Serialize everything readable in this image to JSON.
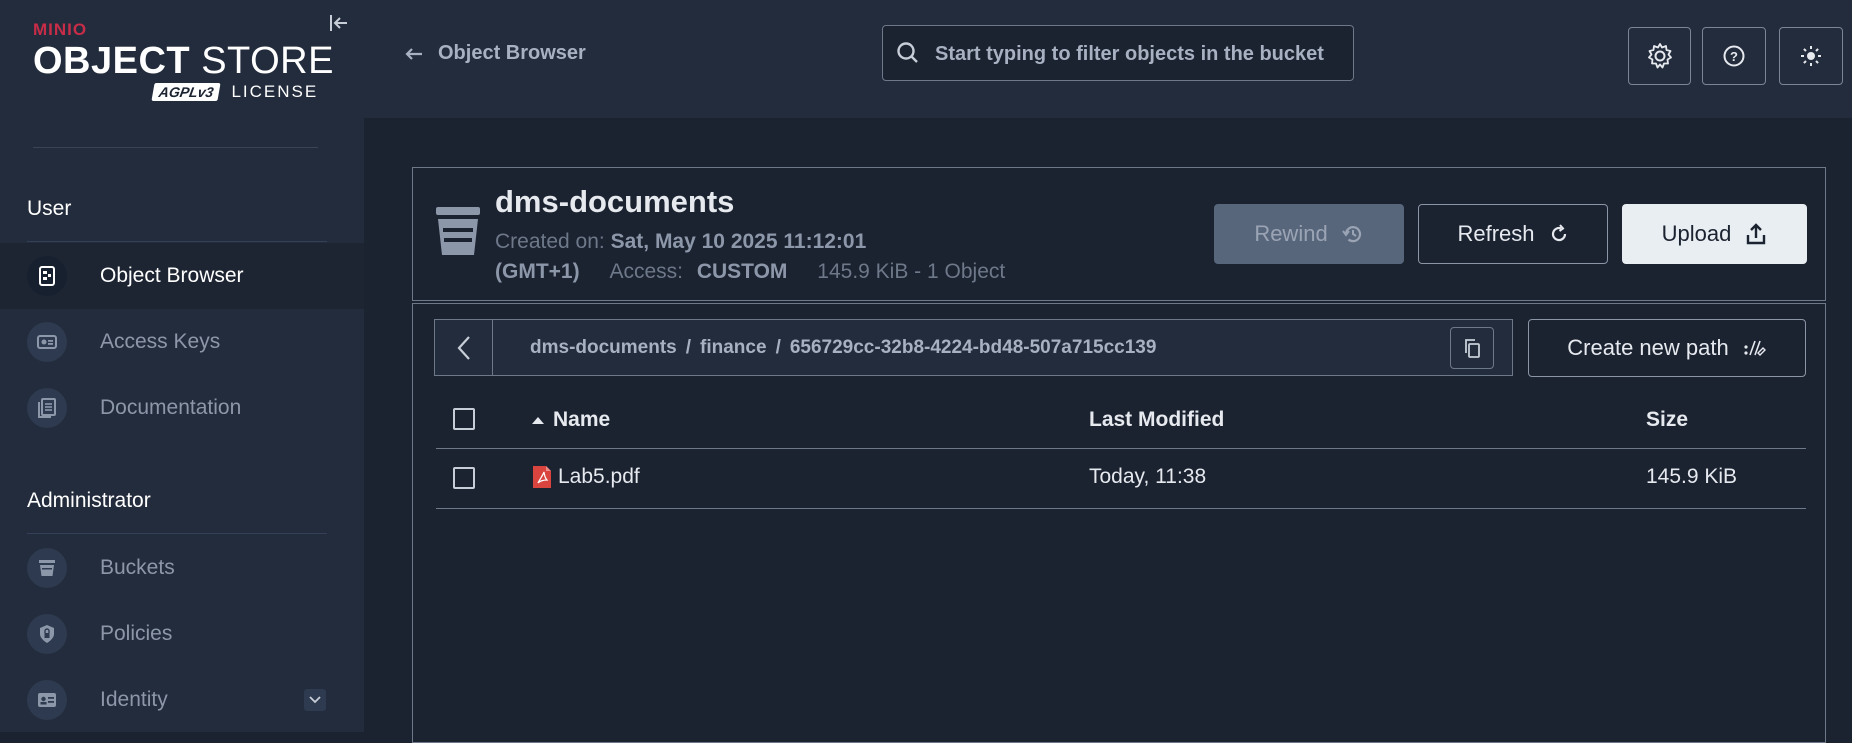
{
  "brand": {
    "minio": "MINIO",
    "product_bold": "OBJECT",
    "product_light": "STORE",
    "agpl": "AGPLv3",
    "license": "LICENSE"
  },
  "sidebar": {
    "user_section": "User",
    "admin_section": "Administrator",
    "user_items": [
      {
        "label": "Object Browser",
        "icon": "object-browser-icon",
        "active": true
      },
      {
        "label": "Access Keys",
        "icon": "access-keys-icon"
      },
      {
        "label": "Documentation",
        "icon": "documentation-icon"
      }
    ],
    "admin_items": [
      {
        "label": "Buckets",
        "icon": "bucket-icon"
      },
      {
        "label": "Policies",
        "icon": "policy-icon"
      },
      {
        "label": "Identity",
        "icon": "identity-icon",
        "expandable": true
      }
    ]
  },
  "topbar": {
    "back_label": "Object Browser",
    "search_placeholder": "Start typing to filter objects in the bucket",
    "buttons": [
      "settings-icon",
      "help-icon",
      "theme-toggle-icon"
    ]
  },
  "bucket": {
    "name": "dms-documents",
    "created_label": "Created on:",
    "created_value": "Sat, May 10 2025 11:12:01",
    "timezone": "(GMT+1)",
    "access_label": "Access:",
    "access_value": "CUSTOM",
    "usage": "145.9 KiB - 1 Object",
    "rewind_label": "Rewind",
    "refresh_label": "Refresh",
    "upload_label": "Upload"
  },
  "path": {
    "segments": [
      "dms-documents",
      "finance",
      "656729cc-32b8-4224-bd48-507a715cc139"
    ],
    "separator": "/",
    "new_path_label": "Create new path"
  },
  "table": {
    "columns": {
      "name": "Name",
      "modified": "Last Modified",
      "size": "Size"
    },
    "sort": "name-ascending",
    "rows": [
      {
        "name": "Lab5.pdf",
        "modified": "Today, 11:38",
        "size": "145.9 KiB",
        "icon": "pdf-file-icon"
      }
    ]
  },
  "colors": {
    "sidebar_bg": "#232c3c",
    "page_bg": "#1b2230",
    "brand_red": "#c72c48",
    "pdf_red": "#d9443f"
  }
}
